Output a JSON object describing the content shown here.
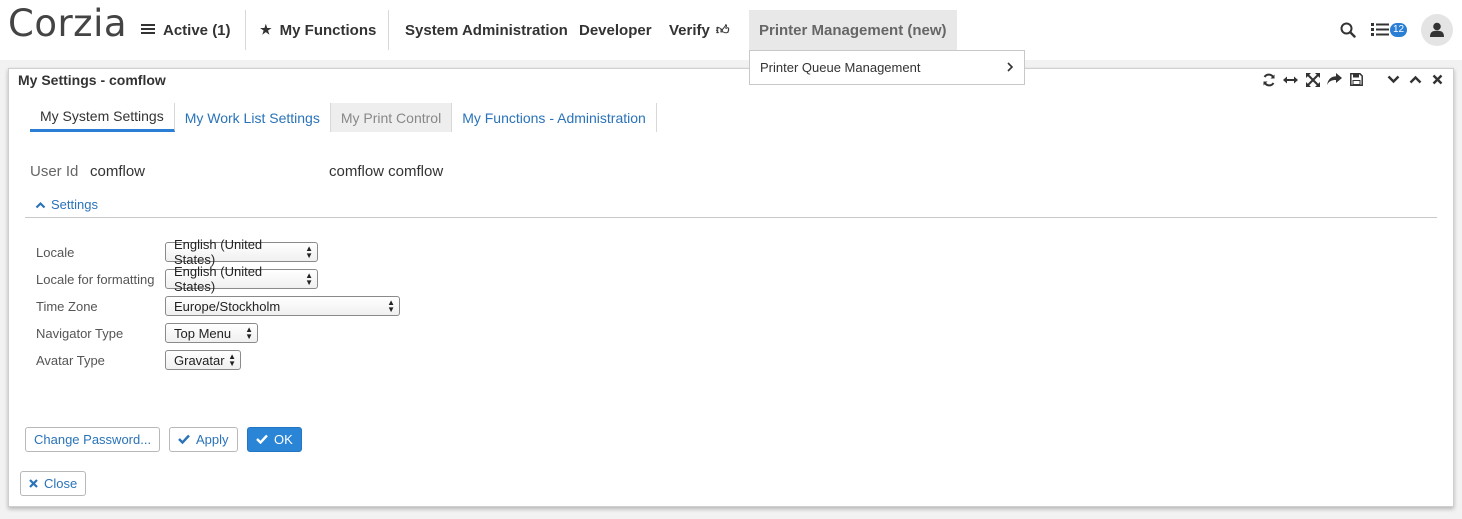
{
  "app": {
    "logo": "Corzia"
  },
  "nav": {
    "active": "Active (1)",
    "my_functions": "My Functions",
    "system_admin": "System Administration",
    "developer": "Developer",
    "verify": "Verify",
    "printer_mgmt": "Printer Management (new)",
    "badge_count": "12"
  },
  "dropdown": {
    "item": "Printer Queue Management"
  },
  "panel": {
    "title": "My Settings - comflow",
    "tabs": [
      "My System Settings",
      "My Work List Settings",
      "My Print Control",
      "My Functions - Administration"
    ],
    "user_id_label": "User Id",
    "user_id_value": "comflow",
    "user_name": "comflow comflow",
    "settings_label": "Settings",
    "fields": [
      {
        "label": "Locale",
        "value": "English (United States)"
      },
      {
        "label": "Locale for formatting",
        "value": "English (United States)"
      },
      {
        "label": "Time Zone",
        "value": "Europe/Stockholm"
      },
      {
        "label": "Navigator Type",
        "value": "Top Menu"
      },
      {
        "label": "Avatar Type",
        "value": "Gravatar"
      }
    ],
    "buttons": {
      "change_password": "Change Password...",
      "apply": "Apply",
      "ok": "OK",
      "close": "Close"
    }
  },
  "colors": {
    "accent": "#2a85d6",
    "link": "#2a73b8"
  }
}
